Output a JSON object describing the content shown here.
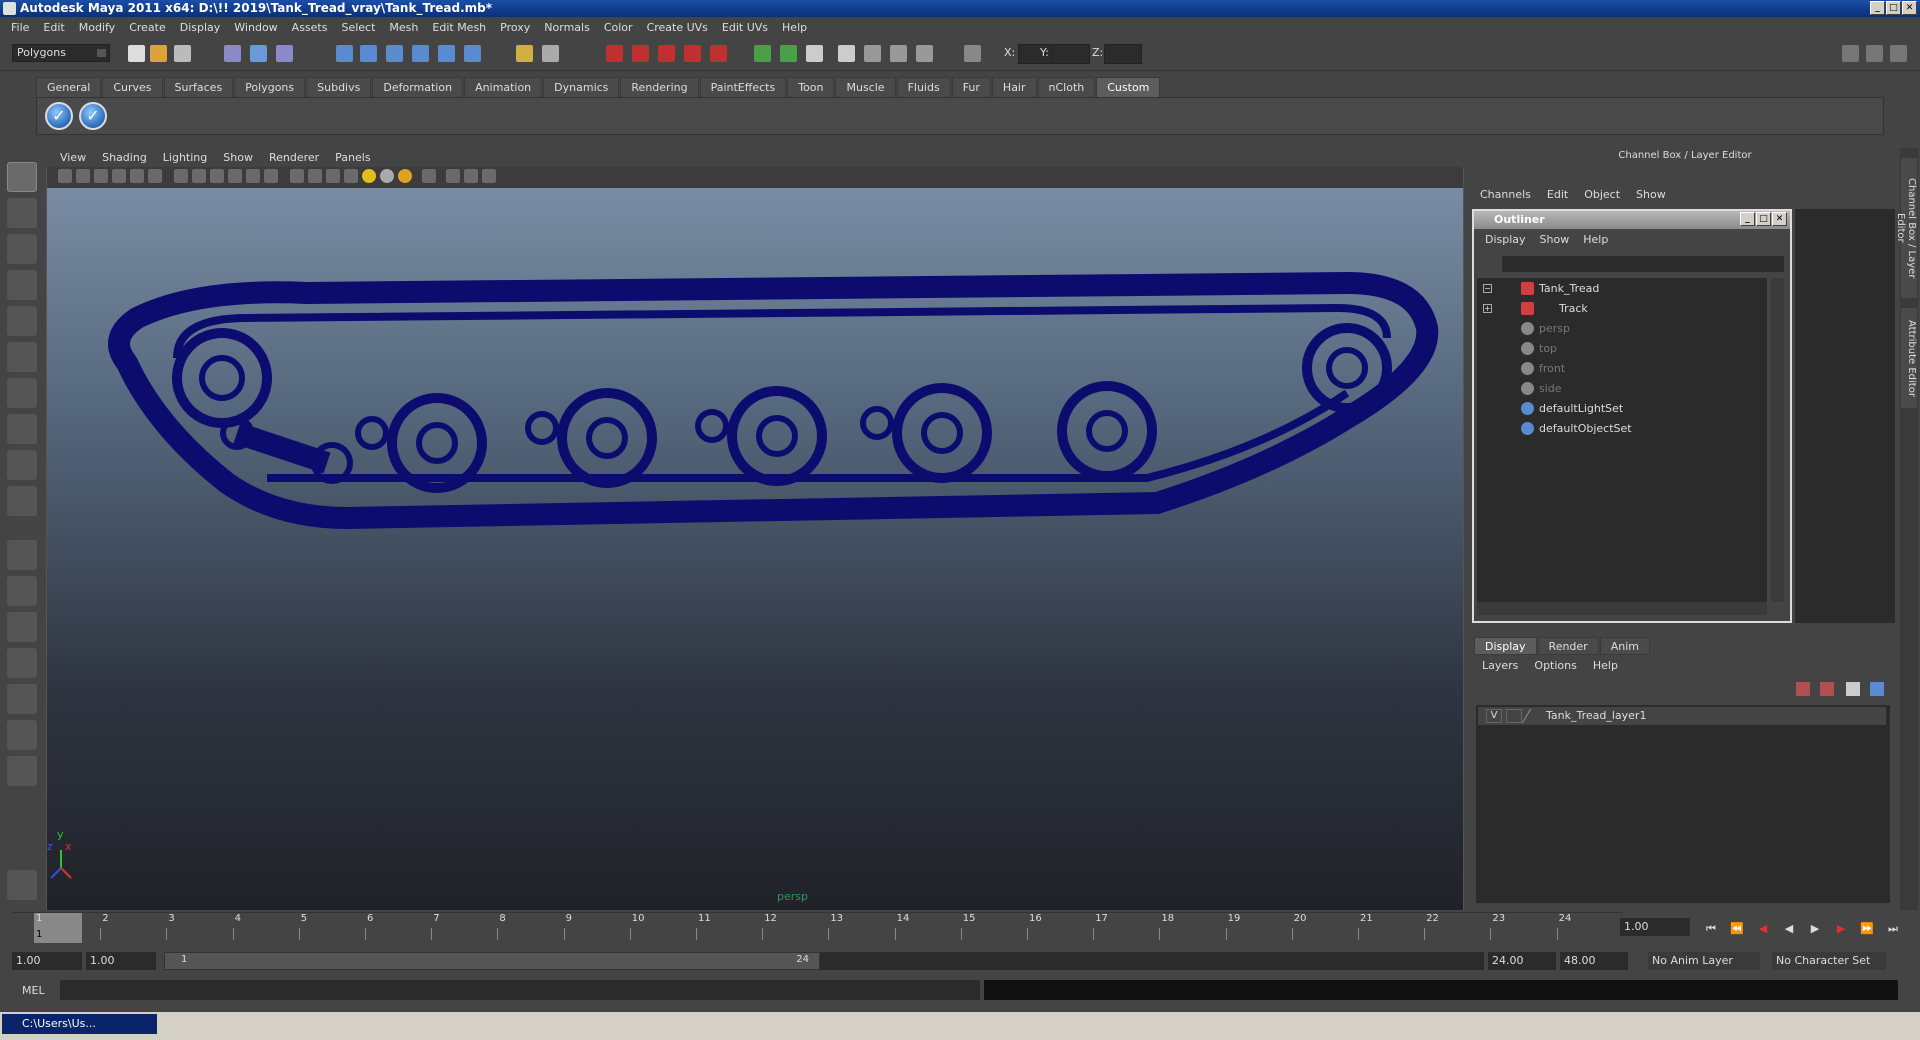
{
  "window": {
    "title": "Autodesk Maya 2011 x64: D:\\!! 2019\\Tank_Tread_vray\\Tank_Tread.mb*"
  },
  "menubar": [
    "File",
    "Edit",
    "Modify",
    "Create",
    "Display",
    "Window",
    "Assets",
    "Select",
    "Mesh",
    "Edit Mesh",
    "Proxy",
    "Normals",
    "Color",
    "Create UVs",
    "Edit UVs",
    "Help"
  ],
  "toolbar": {
    "mode": "Polygons",
    "x_label": "X:",
    "y_label": "Y:",
    "z_label": "Z:"
  },
  "shelf": {
    "tabs": [
      "General",
      "Curves",
      "Surfaces",
      "Polygons",
      "Subdivs",
      "Deformation",
      "Animation",
      "Dynamics",
      "Rendering",
      "PaintEffects",
      "Toon",
      "Muscle",
      "Fluids",
      "Fur",
      "Hair",
      "nCloth",
      "Custom"
    ],
    "active_tab": "Custom"
  },
  "viewport": {
    "menu": [
      "View",
      "Shading",
      "Lighting",
      "Show",
      "Renderer",
      "Panels"
    ],
    "camera_label": "persp",
    "axis_y": "y",
    "axis_x": "x",
    "axis_z": "z",
    "mesh_color": "#0c0c6e"
  },
  "channel_box": {
    "title": "Channel Box / Layer Editor",
    "menu": [
      "Channels",
      "Edit",
      "Object",
      "Show"
    ]
  },
  "outliner": {
    "title": "Outliner",
    "menu": [
      "Display",
      "Show",
      "Help"
    ],
    "items": [
      {
        "label": "Tank_Tread",
        "expander": "−"
      },
      {
        "label": "Track",
        "expander": ""
      },
      {
        "label": "persp",
        "expander": "+"
      },
      {
        "label": "top",
        "expander": ""
      },
      {
        "label": "front",
        "expander": ""
      },
      {
        "label": "side",
        "expander": ""
      },
      {
        "label": "defaultLightSet",
        "expander": ""
      },
      {
        "label": "defaultObjectSet",
        "expander": ""
      }
    ]
  },
  "layer_editor": {
    "tabs": [
      "Display",
      "Render",
      "Anim"
    ],
    "active_tab": "Display",
    "menu": [
      "Layers",
      "Options",
      "Help"
    ],
    "layers": [
      {
        "visible": "V",
        "name": "Tank_Tread_layer1"
      }
    ]
  },
  "side_tabs": [
    "Channel Box / Layer Editor",
    "Attribute Editor"
  ],
  "timeline": {
    "ticks": [
      "1",
      "2",
      "3",
      "4",
      "5",
      "6",
      "7",
      "8",
      "9",
      "10",
      "11",
      "12",
      "13",
      "14",
      "15",
      "16",
      "17",
      "18",
      "19",
      "20",
      "21",
      "22",
      "23",
      "24"
    ],
    "current_frame_marker": "1",
    "current_frame": "1.00"
  },
  "range": {
    "start_time": "1.00",
    "playback_start": "1.00",
    "slider_start": "1",
    "slider_end": "24",
    "playback_end": "24.00",
    "end_time": "48.00",
    "anim_layer": "No Anim Layer",
    "character_set": "No Character Set"
  },
  "cmdline": {
    "label": "MEL"
  },
  "taskbar": {
    "item": "C:\\Users\\Us..."
  }
}
